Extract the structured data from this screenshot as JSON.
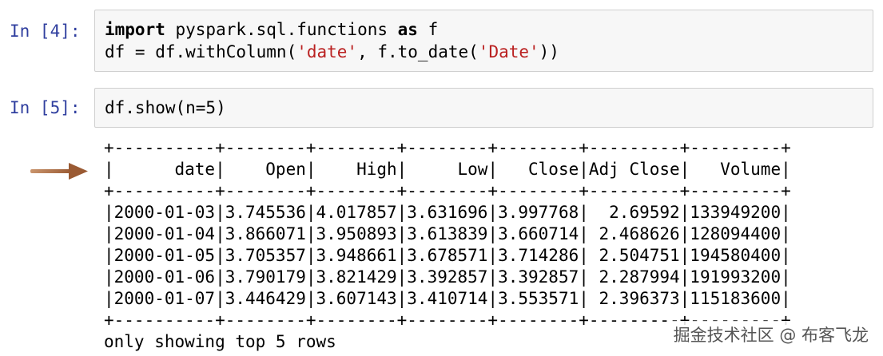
{
  "cells": [
    {
      "prompt": "In [4]:",
      "lines": [
        [
          {
            "t": "import",
            "c": "kw2"
          },
          {
            "t": " pyspark.sql.functions ",
            "c": ""
          },
          {
            "t": "as",
            "c": "kw2"
          },
          {
            "t": " f",
            "c": ""
          }
        ],
        [
          {
            "t": "df = df.withColumn(",
            "c": ""
          },
          {
            "t": "'date'",
            "c": "str"
          },
          {
            "t": ", f.to_date(",
            "c": ""
          },
          {
            "t": "'Date'",
            "c": "str"
          },
          {
            "t": "))",
            "c": ""
          }
        ]
      ]
    },
    {
      "prompt": "In [5]:",
      "lines": [
        [
          {
            "t": "df.show(n=5)",
            "c": ""
          }
        ]
      ]
    }
  ],
  "output": {
    "lines": [
      "+----------+--------+--------+--------+--------+---------+---------+",
      "|      date|    Open|    High|     Low|   Close|Adj Close|   Volume|",
      "+----------+--------+--------+--------+--------+---------+---------+",
      "|2000-01-03|3.745536|4.017857|3.631696|3.997768|  2.69592|133949200|",
      "|2000-01-04|3.866071|3.950893|3.613839|3.660714| 2.468626|128094400|",
      "|2000-01-05|3.705357|3.948661|3.678571|3.714286| 2.504751|194580400|",
      "|2000-01-06|3.790179|3.821429|3.392857|3.392857| 2.287994|191993200|",
      "|2000-01-07|3.446429|3.607143|3.410714|3.553571| 2.396373|115183600|",
      "+----------+--------+--------+--------+--------+---------+---------+",
      "only showing top 5 rows"
    ]
  },
  "watermark": "掘金技术社区 @ 布客飞龙",
  "colors": {
    "prompt": "#303f9f",
    "arrow": "#a0623a",
    "string": "#ba2121"
  },
  "icons": {
    "pointer": "arrow-right-icon"
  }
}
